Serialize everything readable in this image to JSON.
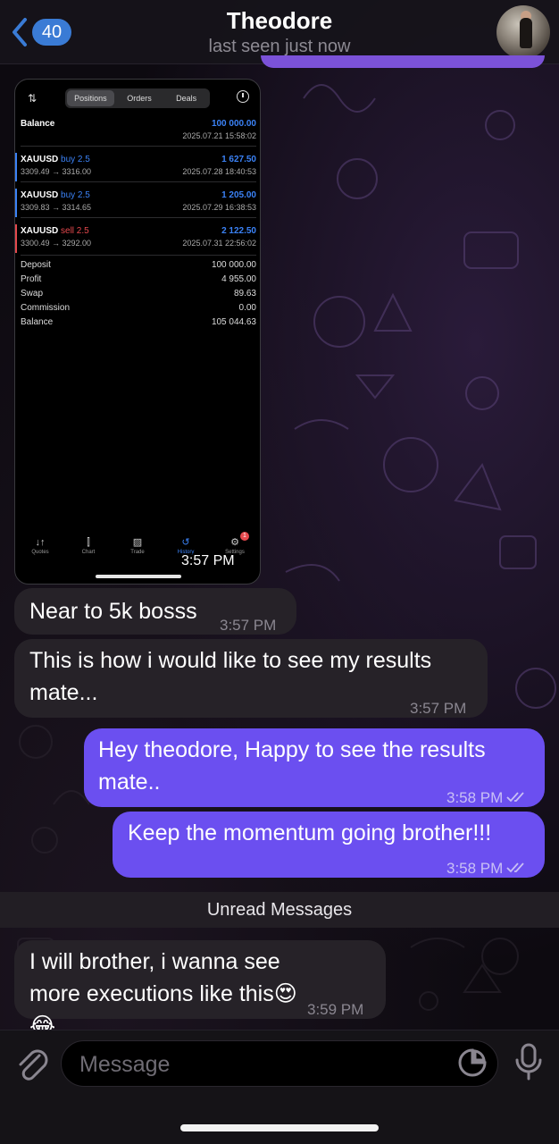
{
  "header": {
    "back_count": "40",
    "title": "Theodore",
    "subtitle": "last seen just now"
  },
  "screenshot": {
    "tabs_top": [
      "Positions",
      "Orders",
      "Deals"
    ],
    "balance_label": "Balance",
    "balance_value": "100 000.00",
    "balance_time": "2025.07.21 15:58:02",
    "positions": [
      {
        "symbol": "XAUUSD",
        "side": "buy 2.5",
        "profit": "1 627.50",
        "prices": "3309.49 → 3316.00",
        "time": "2025.07.28 18:40:53",
        "color": "#3b82f6"
      },
      {
        "symbol": "XAUUSD",
        "side": "buy 2.5",
        "profit": "1 205.00",
        "prices": "3309.83 → 3314.65",
        "time": "2025.07.29 16:38:53",
        "color": "#3b82f6"
      },
      {
        "symbol": "XAUUSD",
        "side": "sell 2.5",
        "profit": "2 122.50",
        "prices": "3300.49 → 3292.00",
        "time": "2025.07.31 22:56:02",
        "color": "#e5484d"
      }
    ],
    "summary": [
      {
        "label": "Deposit",
        "value": "100 000.00"
      },
      {
        "label": "Profit",
        "value": "4 955.00"
      },
      {
        "label": "Swap",
        "value": "89.63"
      },
      {
        "label": "Commission",
        "value": "0.00"
      },
      {
        "label": "Balance",
        "value": "105 044.63"
      }
    ],
    "bottom_tabs": [
      "Quotes",
      "Chart",
      "Trade",
      "History",
      "Settings"
    ],
    "notif_count": "1",
    "time": "3:57 PM"
  },
  "messages": [
    {
      "text": "Near to 5k bosss",
      "time": "3:57 PM"
    },
    {
      "text": "This is how i would like to see my results mate...",
      "time": "3:57 PM"
    },
    {
      "text": "Hey theodore, Happy to see the results mate..",
      "time": "3:58 PM"
    },
    {
      "text": "Keep the momentum going brother!!!",
      "time": "3:58 PM"
    },
    {
      "text": "I will brother, i wanna see more executions like this😍😂",
      "time": "3:59 PM"
    }
  ],
  "unread_label": "Unread Messages",
  "input": {
    "placeholder": "Message"
  },
  "colors": {
    "outgoing": "#6b4ff0",
    "incoming": "#262228",
    "accent": "#3a7bd5"
  }
}
